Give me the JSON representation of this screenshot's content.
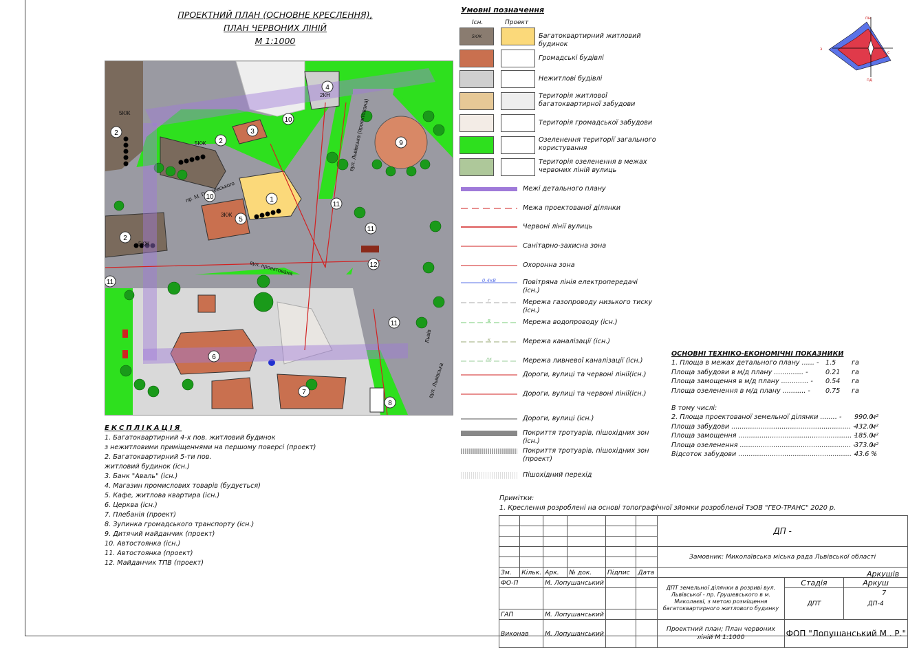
{
  "title": {
    "line1": "ПРОЕКТНИЙ ПЛАН (ОСНОВНЕ КРЕСЛЕННЯ),",
    "line2": "ПЛАН ЧЕРВОНИХ ЛІНІЙ",
    "line3": "М 1:1000"
  },
  "map": {
    "street_labels": [
      "пр. М. Грушевського",
      "вул. Львівська (проектована)",
      "вул. проектована",
      "вул. Львівська",
      "Львів"
    ],
    "building_labels": [
      "5КЖ",
      "5КЖ",
      "5КЖ",
      "3КЖ",
      "2КН"
    ],
    "numbers": [
      "1",
      "2",
      "2",
      "2",
      "3",
      "4",
      "5",
      "6",
      "7",
      "8",
      "9",
      "10",
      "10",
      "11",
      "11",
      "11",
      "11",
      "12"
    ],
    "colors": {
      "road": "#9a9aa2",
      "green": "#2ee01e",
      "public": "#d88866",
      "residential": "#fbd97a",
      "existing_res": "#7a6a5c",
      "paving": "#d9d9d9",
      "plan_boundary": "#9f7ad9",
      "red_line": "#d22222"
    }
  },
  "legend": {
    "title": "Умовні позначення",
    "col_exist": "Існ.",
    "col_project": "Проект",
    "items": [
      {
        "label": "Багатоквартирний житловий будинок",
        "swatch_exist": "#8a7c70",
        "swatch_project": "#fbd97a",
        "text_exist": "5КЖ"
      },
      {
        "label": "Громадські будівлі",
        "swatch_exist": "#c9704f",
        "swatch_project": "#ffffff"
      },
      {
        "label": "Нежитлові будівлі",
        "swatch_exist": "#cfcfcf",
        "swatch_project": "#ffffff"
      },
      {
        "label": "Територія житлової багатоквартирної забудови",
        "swatch_exist": "#e6c896",
        "swatch_project": "#eeeeee"
      },
      {
        "label": "Територія громадської забудови",
        "swatch_exist": "#f3ece6",
        "swatch_project": "#ffffff"
      },
      {
        "label": "Озеленення території загального користування",
        "swatch_exist": "#2ee01e",
        "swatch_project": "#ffffff"
      },
      {
        "label": "Територія озеленення в межах червоних ліній вулиць",
        "swatch_exist": "#aec89a",
        "swatch_project": "#ffffff"
      }
    ],
    "lines": [
      {
        "label": "Межі детального плану"
      },
      {
        "label": "Межа проектованої ділянки"
      },
      {
        "label": "Червоні лінії вулиць"
      },
      {
        "label": "Санітарно-захисна зона"
      },
      {
        "label": "Охоронна зона"
      },
      {
        "label": "Повітряна лінія електропередачі (існ.)",
        "tag": "0,4кВ"
      },
      {
        "label": "Мережа газопроводу низького тиску (існ.)",
        "tag": "г"
      },
      {
        "label": "Мережа водопроводу (існ.)",
        "tag": "в"
      },
      {
        "label": "Мережа каналізації (існ.)",
        "tag": "к"
      },
      {
        "label": "Мережа ливневої каналізації (існ.)",
        "tag": "лк"
      },
      {
        "label": "Дороги, вулиці та червоні лінії(існ.)"
      },
      {
        "label": "Дороги, вулиці та червоні лінії(існ.)"
      },
      {
        "label": "Дороги, вулиці (існ.)"
      },
      {
        "label": "Покриття тротуарів, пішохідних зон (існ.)"
      },
      {
        "label": "Покриття тротуарів, пішохідних зон (проект)"
      },
      {
        "label": "Пішохідний перехід"
      }
    ]
  },
  "explication": {
    "title": "ЕКСПЛІКАЦІЯ",
    "items": [
      "1.  Багатоквартирний 4-х пов. житловий будинок",
      "      з нежитловими приміщеннями на першому поверсі (проект)",
      "2. Багатоквартирний 5-ти пов.",
      "    житловий будинок (існ.)",
      "3. Банк \"Аваль\" (існ.)",
      "4. Магазин промислових товарів (будується)",
      "5. Кафе, житлова квартира (існ.)",
      "6. Церква (існ.)",
      "7. Плебанія (проект)",
      "8. Зупинка громадського транспорту (існ.)",
      "9. Дитячий майданчик (проект)",
      "10. Автостоянка (існ.)",
      "11. Автостоянка (проект)",
      "12. Майданчик ТПВ (проект)"
    ]
  },
  "tep": {
    "title": "ОСНОВНІ ТЕХНІКО-ЕКОНОМІЧНІ ПОКАЗНИКИ",
    "rows": [
      {
        "label": "1. Площа в межах детального плану ...... -",
        "value": "1.5",
        "unit": "га"
      },
      {
        "label": "    Площа забудови в м/д плану .............. -",
        "value": "0.21",
        "unit": "га"
      },
      {
        "label": "    Площа замощення в м/д плану ............. -",
        "value": "0.54",
        "unit": "га"
      },
      {
        "label": "    Площа озеленення в м/д плану ........... -",
        "value": "0.75",
        "unit": "га"
      }
    ],
    "subtitle": "В тому числі:",
    "rows2": [
      {
        "label": "2. Площа проектованої земельної ділянки ........ -",
        "value": "990.0",
        "unit": "м²"
      },
      {
        "label": "    Площа забудови ......................................................... -",
        "value": "432.0",
        "unit": "м²"
      },
      {
        "label": "    Площа замощення ...................................................... -",
        "value": "185.0",
        "unit": "м²"
      },
      {
        "label": "    Площа озеленення ..................................................... -",
        "value": "373.0",
        "unit": "м²"
      },
      {
        "label": "    Відсоток забудови ...................................................... -",
        "value": "43.6",
        "unit": "%"
      }
    ]
  },
  "notes": {
    "title": "Примітки:",
    "line1": "1. Креслення розроблені на основі  топографічної зйомки розробленої ТзОВ \"ГЕО-ТРАНС\" 2020 р."
  },
  "stamp": {
    "code": "ДП -",
    "customer": "Замовник: Миколаївська міська рада Львівської області",
    "headers": [
      "Зм.",
      "Кільк.",
      "Арк.",
      "№ док.",
      "Підпис",
      "Дата"
    ],
    "roles": [
      {
        "role": "ФО-П",
        "name": "М. Лопушанський"
      },
      {
        "role": "ГАП",
        "name": "М. Лопушанський"
      },
      {
        "role": "Виконав",
        "name": "М. Лопушанський"
      }
    ],
    "project": "ДПТ земельної ділянки в розриві вул. Львівської - пр. Грушевського в м. Миколаєві,  з метою розміщення багатоквартирного житлового будинку",
    "sheet_title": "Проектний план; План червоних ліній М 1:1000",
    "stage_h": "Стадія",
    "sheet_h": "Аркуш",
    "sheets_h": "Аркушів",
    "stage": "ДПТ",
    "sheet": "ДП-4",
    "sheets": "7",
    "firm": "ФОП \"Лопушанський М . Р.\""
  },
  "compass": {
    "labels": [
      "пн",
      "з",
      "с",
      "пд"
    ]
  }
}
